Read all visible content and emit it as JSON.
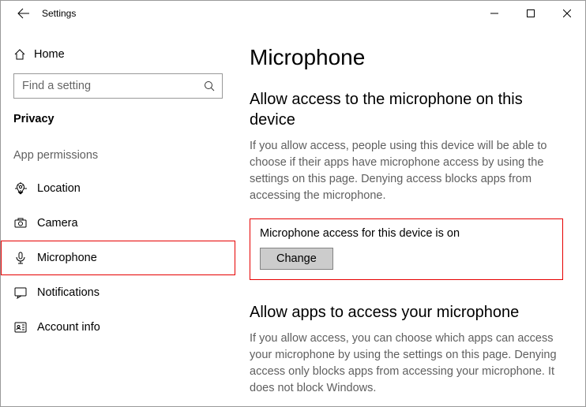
{
  "app_title": "Settings",
  "sidebar": {
    "home_label": "Home",
    "search_placeholder": "Find a setting",
    "category": "Privacy",
    "section_label": "App permissions",
    "items": {
      "location": "Location",
      "camera": "Camera",
      "microphone": "Microphone",
      "notifications": "Notifications",
      "account_info": "Account info"
    }
  },
  "main": {
    "page_title": "Microphone",
    "section1": {
      "title": "Allow access to the microphone on this device",
      "desc": "If you allow access, people using this device will be able to choose if their apps have microphone access by using the settings on this page. Denying access blocks apps from accessing the microphone.",
      "status": "Microphone access for this device is on",
      "change_label": "Change"
    },
    "section2": {
      "title": "Allow apps to access your microphone",
      "desc": "If you allow access, you can choose which apps can access your microphone by using the settings on this page. Denying access only blocks apps from accessing your microphone. It does not block Windows."
    }
  }
}
